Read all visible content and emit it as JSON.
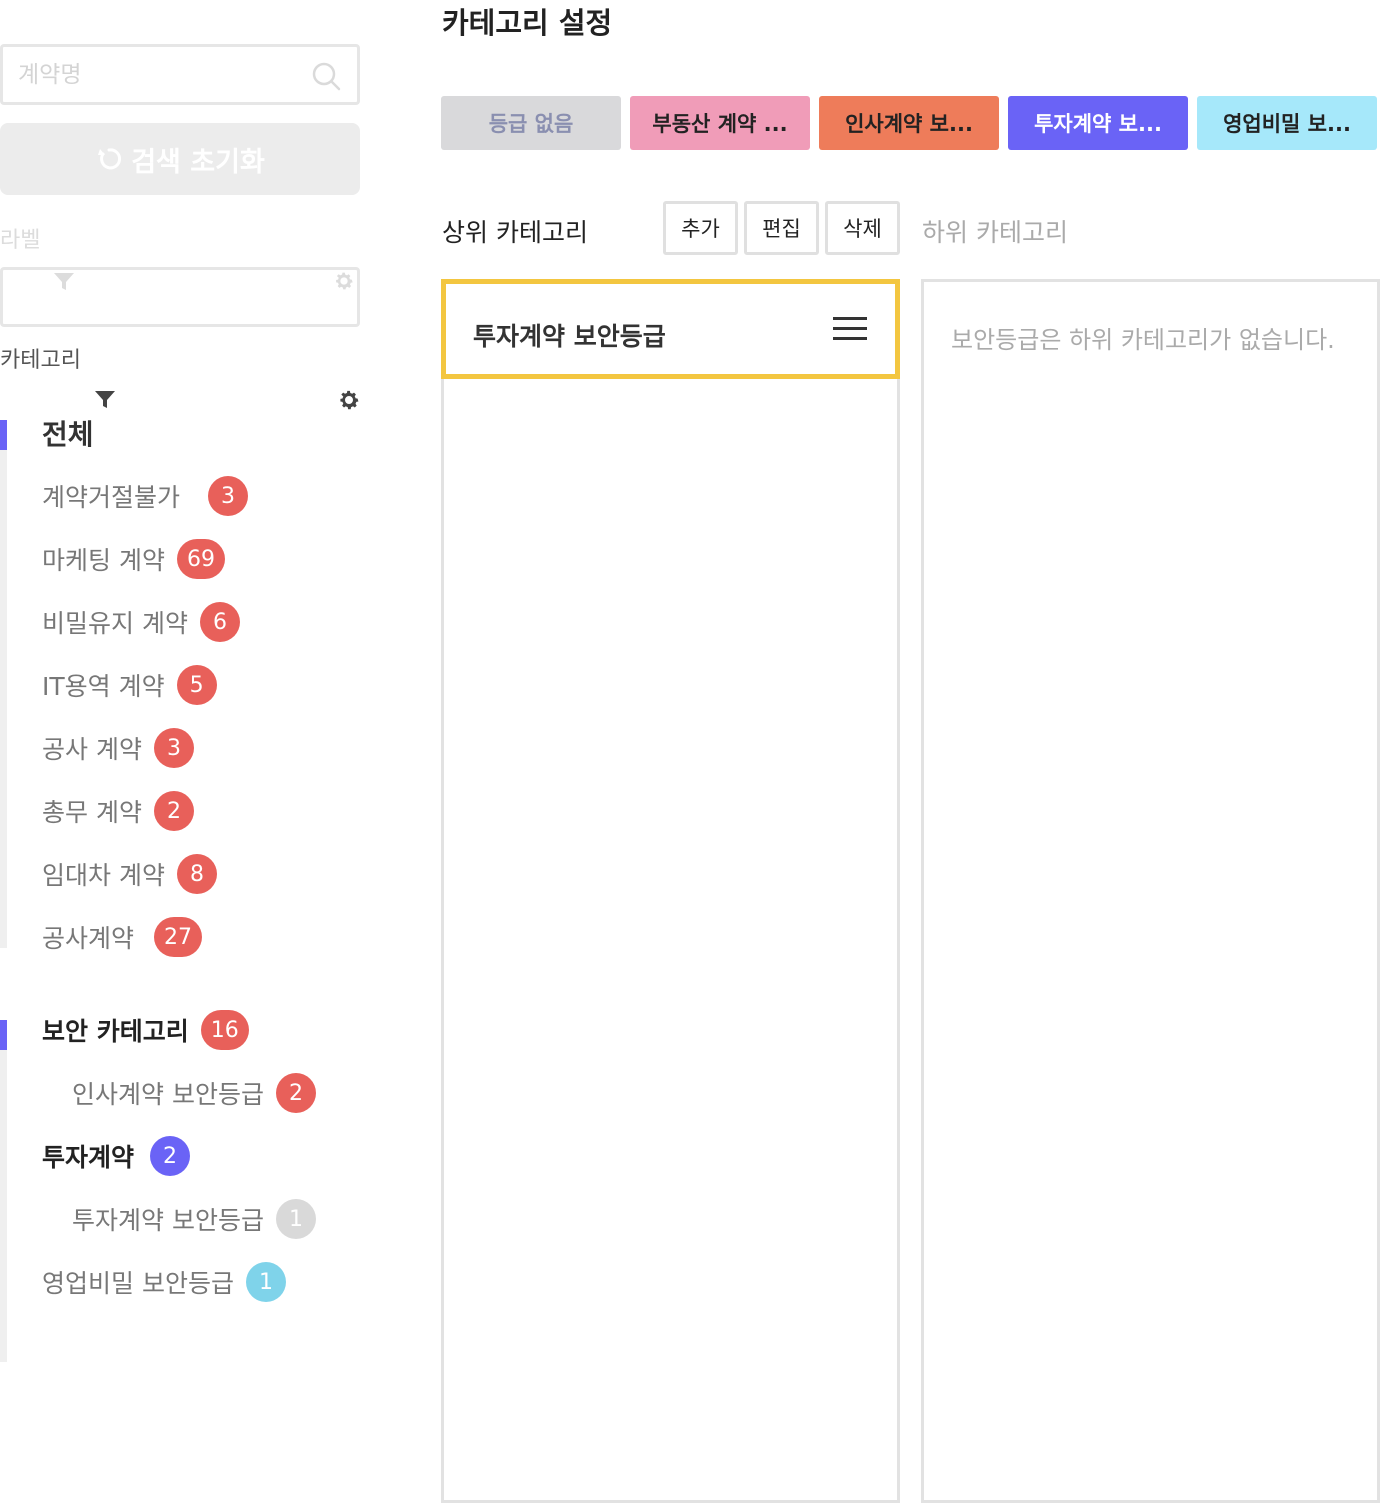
{
  "sidebar": {
    "search": {
      "placeholder": "계약명",
      "value": ""
    },
    "reset_label": "검색 초기화",
    "label_title": "라벨",
    "category_title": "카테고리",
    "tree": [
      {
        "label": "전체",
        "count": null
      },
      {
        "label": "계약거절불가",
        "count": "3",
        "badge_color": "#e8605a"
      },
      {
        "label": "마케팅 계약",
        "count": "69",
        "badge_color": "#e8605a"
      },
      {
        "label": "비밀유지 계약",
        "count": "6",
        "badge_color": "#e8605a"
      },
      {
        "label": "IT용역 계약",
        "count": "5",
        "badge_color": "#e8605a"
      },
      {
        "label": "공사 계약",
        "count": "3",
        "badge_color": "#e8605a"
      },
      {
        "label": "총무 계약",
        "count": "2",
        "badge_color": "#e8605a"
      },
      {
        "label": "임대차 계약",
        "count": "8",
        "badge_color": "#e8605a"
      },
      {
        "label": "공사계약",
        "count": "27",
        "badge_color": "#e8605a"
      }
    ],
    "security_tree": [
      {
        "label": "보안 카테고리",
        "count": "16",
        "badge_color": "#e8605a"
      },
      {
        "label": "인사계약 보안등급",
        "count": "2",
        "badge_color": "#e8605a"
      },
      {
        "label": "투자계약",
        "count": "2",
        "badge_color": "#6a63f6"
      },
      {
        "label": "투자계약 보안등급",
        "count": "1",
        "badge_color": "#d9d9d9"
      },
      {
        "label": "영업비밀 보안등급",
        "count": "1",
        "badge_color": "#7fd3ea"
      }
    ]
  },
  "main": {
    "title": "카테고리 설정",
    "grade_tabs": [
      {
        "label": "등급 없음",
        "bg": "#d9d9db",
        "fg": "#8a8fb0"
      },
      {
        "label": "부동산 계약 ...",
        "bg": "#f09cb8",
        "fg": "#222222"
      },
      {
        "label": "인사계약 보...",
        "bg": "#ee7c5a",
        "fg": "#222222"
      },
      {
        "label": "투자계약 보...",
        "bg": "#6a63f6",
        "fg": "#ffffff"
      },
      {
        "label": "영업비밀 보...",
        "bg": "#a6e8fa",
        "fg": "#222222"
      }
    ],
    "parent_heading": "상위 카테고리",
    "child_heading": "하위 카테고리",
    "buttons": {
      "add": "추가",
      "edit": "편집",
      "delete": "삭제"
    },
    "selected_parent": "투자계약 보안등급",
    "empty_child_message": "보안등급은 하위 카테고리가 없습니다."
  }
}
